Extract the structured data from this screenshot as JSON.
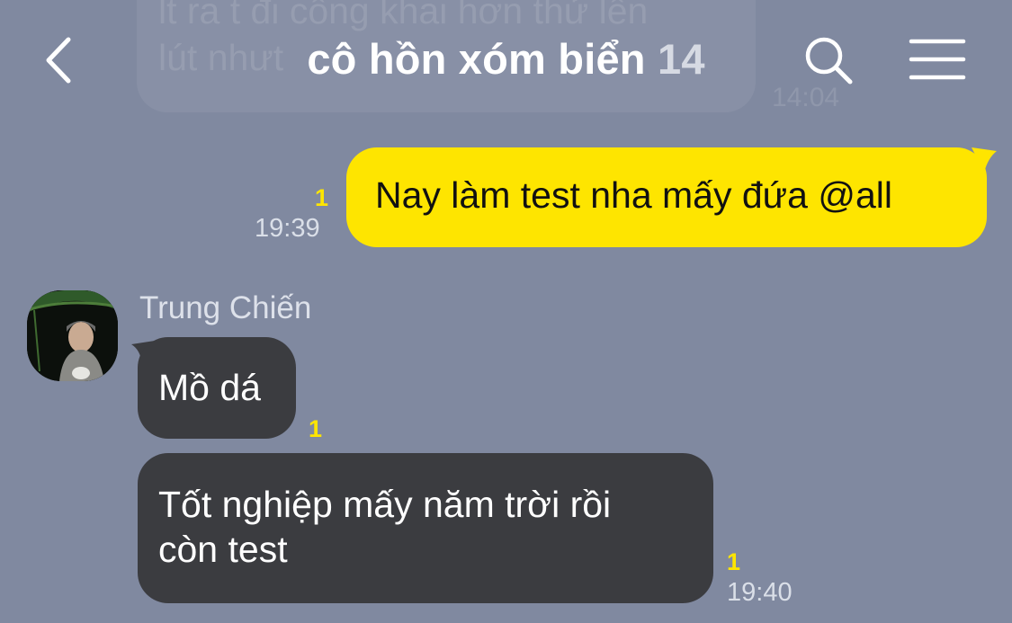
{
  "previous_message": {
    "text": "lt ra t đi công khai hơn thử lên\nlút nhưt",
    "time": "14:04"
  },
  "header": {
    "title": "cô hồn xóm biển",
    "member_count": "14",
    "back_icon": "chevron-left-icon",
    "search_icon": "search-icon",
    "menu_icon": "hamburger-menu-icon"
  },
  "messages": [
    {
      "direction": "outgoing",
      "text": "Nay làm test nha mấy đứa @all",
      "unread": "1",
      "time": "19:39"
    },
    {
      "direction": "incoming",
      "sender": "Trung Chiến",
      "text": "Mồ dá",
      "unread": "1",
      "time": ""
    },
    {
      "direction": "incoming",
      "sender": "Trung Chiến",
      "text": "Tốt nghiệp mấy năm trời rồi\ncòn test",
      "unread": "1",
      "time": "19:40"
    }
  ],
  "colors": {
    "background": "#8089a0",
    "outgoing_bubble": "#fee500",
    "incoming_bubble": "#3b3c40",
    "unread_count": "#fee500"
  }
}
